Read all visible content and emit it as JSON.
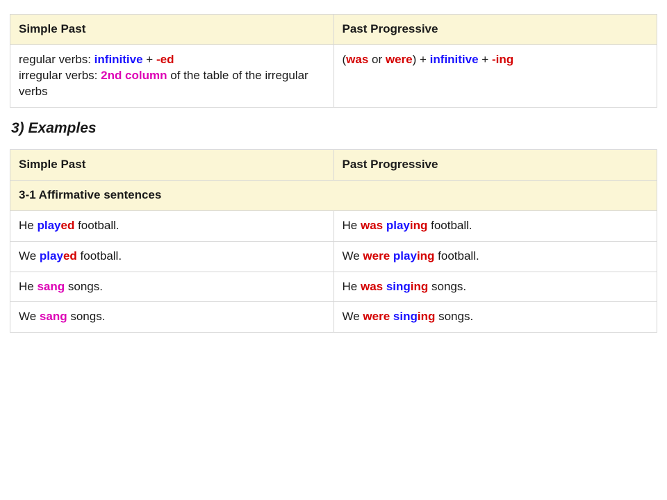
{
  "table1": {
    "headers": {
      "left": "Simple Past",
      "right": "Past Progressive"
    },
    "row": {
      "simple": {
        "regular_prefix": "regular verbs: ",
        "infinitive": "infinitive",
        "plus1": " + ",
        "ed": "-ed",
        "irregular_prefix": "irregular verbs: ",
        "second_col": "2nd column",
        "irregular_suffix": " of the table of the irregular verbs"
      },
      "prog": {
        "open": "(",
        "was": "was",
        "or": " or ",
        "were": "were",
        "close_plus": ") + ",
        "infinitive": "infinitive",
        "plus2": " + ",
        "ing": "-ing"
      }
    }
  },
  "section_title": "3) Examples",
  "table2": {
    "headers": {
      "left": "Simple Past",
      "right": "Past Progressive"
    },
    "subhead": "3-1 Affirmative sentences",
    "rows": [
      {
        "l": {
          "pre": "He ",
          "stem": "play",
          "suf": "ed",
          "post": " football."
        },
        "r": {
          "pre": "He ",
          "aux": "was",
          "mid": " ",
          "stem": "play",
          "suf": "ing",
          "post": " football."
        }
      },
      {
        "l": {
          "pre": "We ",
          "stem": "play",
          "suf": "ed",
          "post": " football."
        },
        "r": {
          "pre": "We ",
          "aux": "were",
          "mid": " ",
          "stem": "play",
          "suf": "ing",
          "post": " football."
        }
      },
      {
        "l": {
          "pre": "He ",
          "stem": "sang",
          "suf": "",
          "post": " songs."
        },
        "r": {
          "pre": "He ",
          "aux": "was",
          "mid": " ",
          "stem": "sing",
          "suf": "ing",
          "post": " songs."
        }
      },
      {
        "l": {
          "pre": "We ",
          "stem": "sang",
          "suf": "",
          "post": " songs."
        },
        "r": {
          "pre": "We ",
          "aux": "were",
          "mid": " ",
          "stem": "sing",
          "suf": "ing",
          "post": " songs."
        }
      }
    ]
  }
}
